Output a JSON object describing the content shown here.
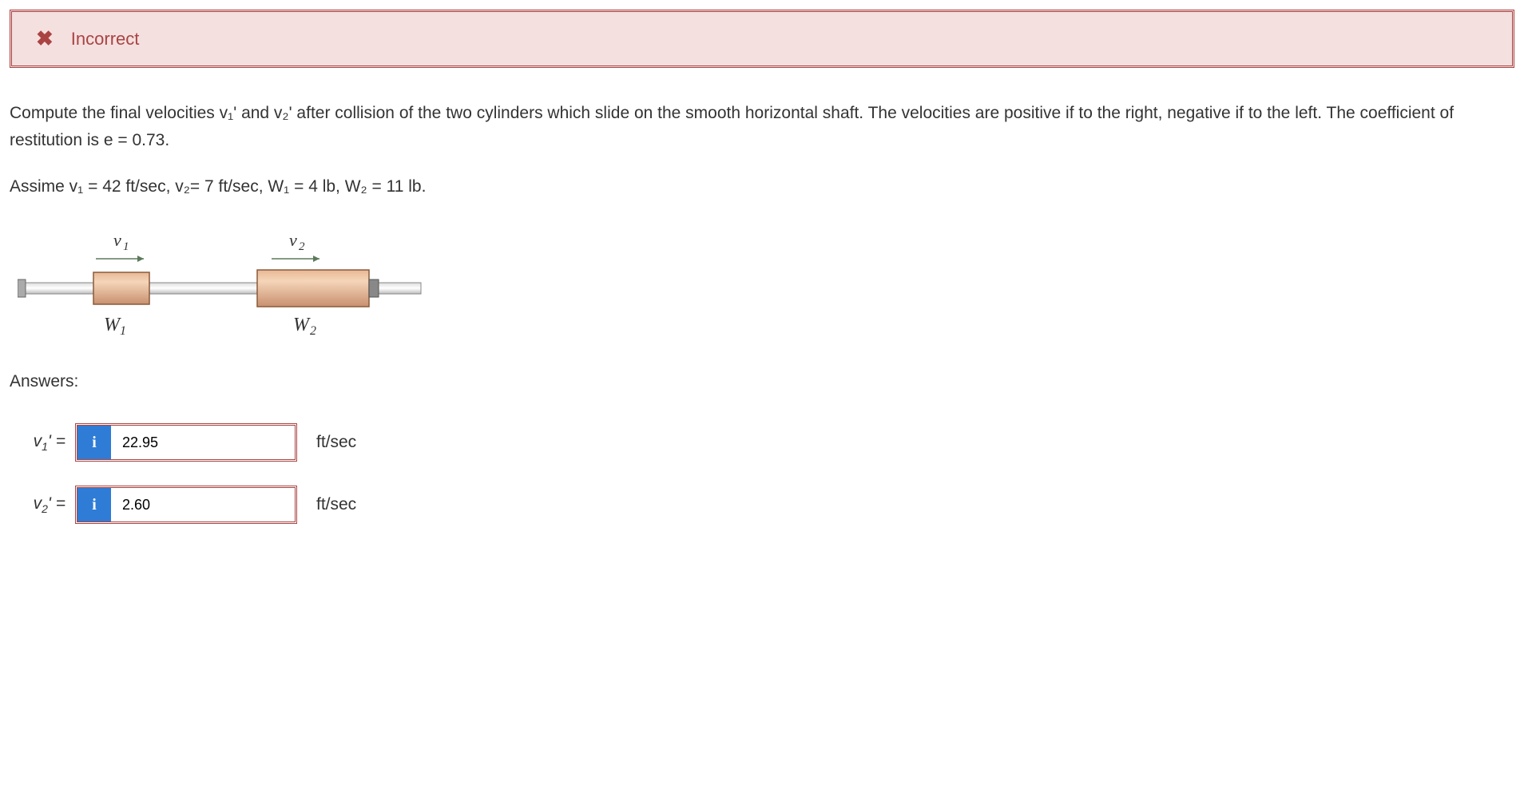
{
  "feedback": {
    "status": "Incorrect",
    "icon": "✖"
  },
  "problem": {
    "text1": "Compute the final velocities v₁' and v₂' after collision of the two cylinders which slide on the smooth horizontal shaft. The velocities are positive if to the right, negative if to the left. The coefficient of restitution is e = 0.73.",
    "text2": "Assime v₁ = 42 ft/sec, v₂= 7 ft/sec, W₁ = 4 lb, W₂ = 11 lb."
  },
  "diagram": {
    "v1_label": "v₁",
    "v2_label": "v₂",
    "w1_label": "W₁",
    "w2_label": "W₂"
  },
  "answers": {
    "heading": "Answers:",
    "rows": [
      {
        "label_var": "v",
        "label_sub": "1",
        "label_suffix": "' =",
        "value": "22.95",
        "unit": "ft/sec"
      },
      {
        "label_var": "v",
        "label_sub": "2",
        "label_suffix": "' =",
        "value": "2.60",
        "unit": "ft/sec"
      }
    ],
    "info_icon": "i"
  }
}
